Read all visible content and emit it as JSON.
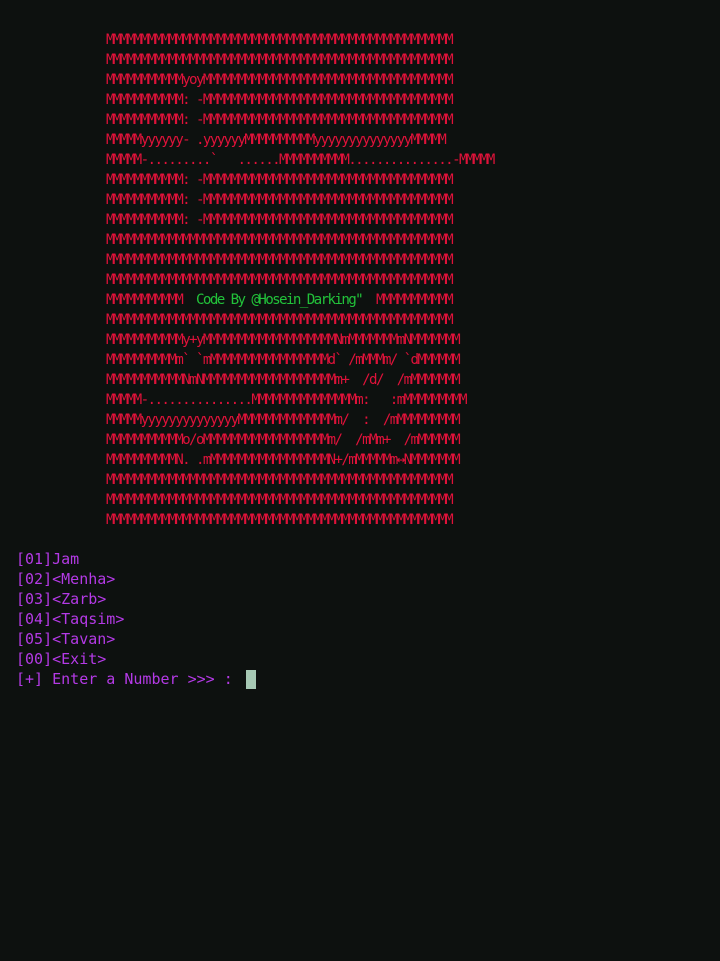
{
  "colors": {
    "background": "#0d110f",
    "ascii_art": "#e0123a",
    "credit": "#22c23a",
    "menu": "#b43ae6",
    "cursor": "#a6c9b4"
  },
  "banner": {
    "line_1": "MMMMMMMMMMMMMMMMMMMMMMMMMMMMMMMMMMMMMMMMMMMMMMMMMM",
    "line_2": "MMMMMMMMMMMMMMMMMMMMMMMMMMMMMMMMMMMMMMMMMMMMMMMMMM",
    "line_3": "MMMMMMMMMMMyoyMMMMMMMMMMMMMMMMMMMMMMMMMMMMMMMMMMMM",
    "line_4": "MMMMMMMMMMM: -MMMMMMMMMMMMMMMMMMMMMMMMMMMMMMMMMMMM",
    "line_5": "MMMMMMMMMMM: -MMMMMMMMMMMMMMMMMMMMMMMMMMMMMMMMMMMM",
    "line_6": "MMMMMyyyyyy- .yyyyyyMMMMMMMMMMyyyyyyyyyyyyyyMMMMM",
    "line_7": "MMMMM-.........`   ......MMMMMMMMMM...............-MMMMM",
    "line_8": "MMMMMMMMMMM: -MMMMMMMMMMMMMMMMMMMMMMMMMMMMMMMMMMMM",
    "line_9": "MMMMMMMMMMM: -MMMMMMMMMMMMMMMMMMMMMMMMMMMMMMMMMMMM",
    "line_10": "MMMMMMMMMMM: -MMMMMMMMMMMMMMMMMMMMMMMMMMMMMMMMMMMM",
    "line_11": "MMMMMMMMMMMMMMMMMMMMMMMMMMMMMMMMMMMMMMMMMMMMMMMMMM",
    "line_12": "MMMMMMMMMMMMMMMMMMMMMMMMMMMMMMMMMMMMMMMMMMMMMMMMMM",
    "line_13": "MMMMMMMMMMMMMMMMMMMMMMMMMMMMMMMMMMMMMMMMMMMMMMMMMM",
    "line_14_left": "MMMMMMMMMMM  ",
    "credit_text": "Code By @Hosein_Darking\"",
    "line_14_right": "  MMMMMMMMMMM",
    "line_15": "MMMMMMMMMMMMMMMMMMMMMMMMMMMMMMMMMMMMMMMMMMMMMMMMMM",
    "line_16": "MMMMMMMMMMMy+yMMMMMMMMMMMMMMMMMMMNmMMMMMMMmNMMMMMMM",
    "line_17": "MMMMMMMMMMm` `mMMMMMMMMMMMMMMMMMd` /mMMMm/ `dMMMMMM",
    "line_18": "MMMMMMMMMMMNmNMMMMMMMMMMMMMMMMMMMm+  /d/  /mMMMMMMM",
    "line_19": "MMMMM-...............MMMMMMMMMMMMMMMm:   :mMMMMMMMMM",
    "line_20": "MMMMMyyyyyyyyyyyyyyMMMMMMMMMMMMMMm/  :  /mMMMMMMMMM",
    "line_21": "MMMMMMMMMMMo/oMMMMMMMMMMMMMMMMMMm/  /mMm+  /mMMMMMM",
    "line_22": "MMMMMMMMMMN. .mMMMMMMMMMMMMMMMMMN+/mMMMMMm↔NMMMMMMM",
    "line_23": "MMMMMMMMMMMMMMMMMMMMMMMMMMMMMMMMMMMMMMMMMMMMMMMMMM",
    "line_24": "MMMMMMMMMMMMMMMMMMMMMMMMMMMMMMMMMMMMMMMMMMMMMMMMMM",
    "line_25": "MMMMMMMMMMMMMMMMMMMMMMMMMMMMMMMMMMMMMMMMMMMMMMMMMM"
  },
  "menu": {
    "option_01": "[01]Jam",
    "option_02": "[02]<Menha>",
    "option_03": "[03]<Zarb>",
    "option_04": "[04]<Taqsim>",
    "option_05": "[05]<Tavan>",
    "option_00": "[00]<Exit>"
  },
  "prompt": {
    "text": "[+] Enter a Number >>> : "
  }
}
